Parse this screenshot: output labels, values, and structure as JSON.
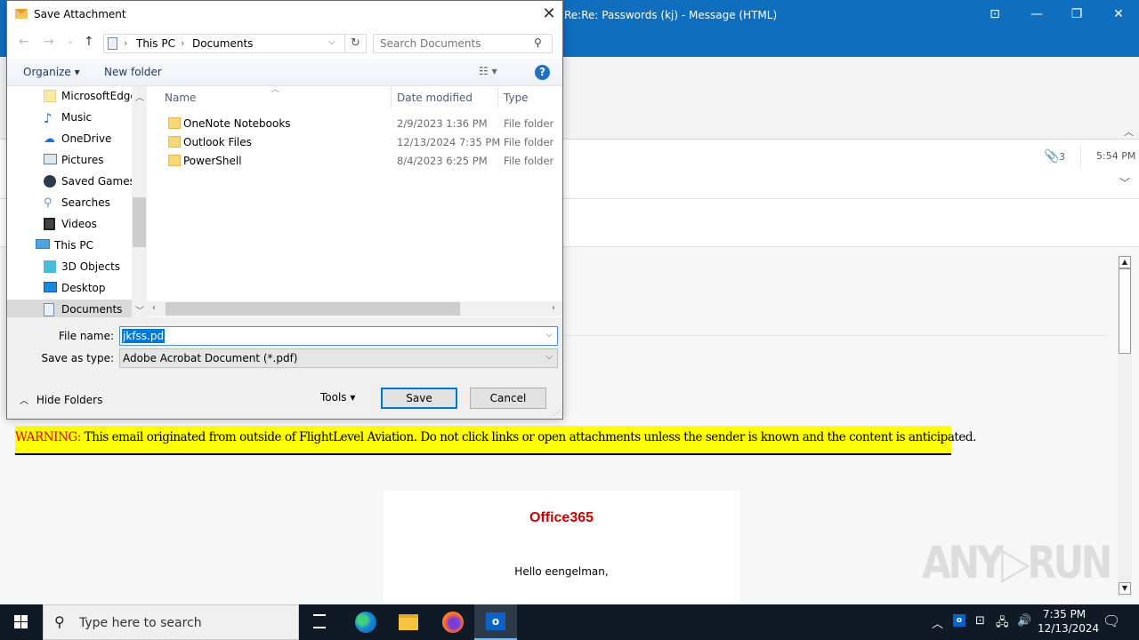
{
  "outlook": {
    "window_title": "Re:Re:  Passwords   (kj)  -  Message (HTML)",
    "window_buttons": {
      "ribbon_display": "⊡",
      "minimize": "—",
      "restore": "❐",
      "close": "✕"
    },
    "attachment_count": "3",
    "received_time": "5:54 PM",
    "warning": {
      "label": "WARNING:",
      "text": " This email originated from outside of FlightLevel  Aviation. Do not click links or open attachments unless the sender is known and the content is anticipated."
    },
    "email_brand": "Office365",
    "email_greeting": "Hello eengelman,",
    "watermark": "ANY▷RUN"
  },
  "dialog": {
    "title": "Save Attachment",
    "close": "✕",
    "nav": {
      "back": "←",
      "forward": "→",
      "recent": "⌄",
      "up": "↑"
    },
    "breadcrumb": [
      "This PC",
      "Documents"
    ],
    "search_placeholder": "Search Documents",
    "toolbar": {
      "organize": "Organize ▾",
      "new_folder": "New folder",
      "view": "☷  ▾",
      "help": "?"
    },
    "tree": [
      {
        "label": "MicrosoftEdge",
        "icon": "folder-icon",
        "indent": 2
      },
      {
        "label": "Music",
        "icon": "music-icon",
        "indent": 2
      },
      {
        "label": "OneDrive",
        "icon": "onedrive-icon",
        "indent": 2
      },
      {
        "label": "Pictures",
        "icon": "pictures-icon",
        "indent": 2
      },
      {
        "label": "Saved Games",
        "icon": "saved-games-icon",
        "indent": 2
      },
      {
        "label": "Searches",
        "icon": "searches-icon",
        "indent": 2
      },
      {
        "label": "Videos",
        "icon": "videos-icon",
        "indent": 2
      },
      {
        "label": "This PC",
        "icon": "this-pc-icon",
        "indent": 1
      },
      {
        "label": "3D Objects",
        "icon": "3d-objects-icon",
        "indent": 2
      },
      {
        "label": "Desktop",
        "icon": "desktop-icon",
        "indent": 2
      },
      {
        "label": "Documents",
        "icon": "documents-icon",
        "indent": 2,
        "selected": true
      }
    ],
    "columns": {
      "name": "Name",
      "date": "Date modified",
      "type": "Type"
    },
    "files": [
      {
        "name": "OneNote Notebooks",
        "date": "2/9/2023 1:36 PM",
        "type": "File folder"
      },
      {
        "name": "Outlook Files",
        "date": "12/13/2024 7:35 PM",
        "type": "File folder"
      },
      {
        "name": "PowerShell",
        "date": "8/4/2023 6:25 PM",
        "type": "File folder"
      }
    ],
    "file_name_label": "File name:",
    "file_name_value": "jkfss.pdf",
    "save_type_label": "Save as type:",
    "save_type_value": "Adobe Acrobat Document (*.pdf)",
    "hide_folders": "Hide Folders",
    "tools": "Tools   ▾",
    "save": "Save",
    "cancel": "Cancel"
  },
  "taskbar": {
    "search_placeholder": "Type here to search",
    "apps": [
      "task-view",
      "edge",
      "file-explorer",
      "firefox",
      "outlook"
    ],
    "active_app": "outlook",
    "clock_time": "7:35 PM",
    "clock_date": "12/13/2024"
  }
}
